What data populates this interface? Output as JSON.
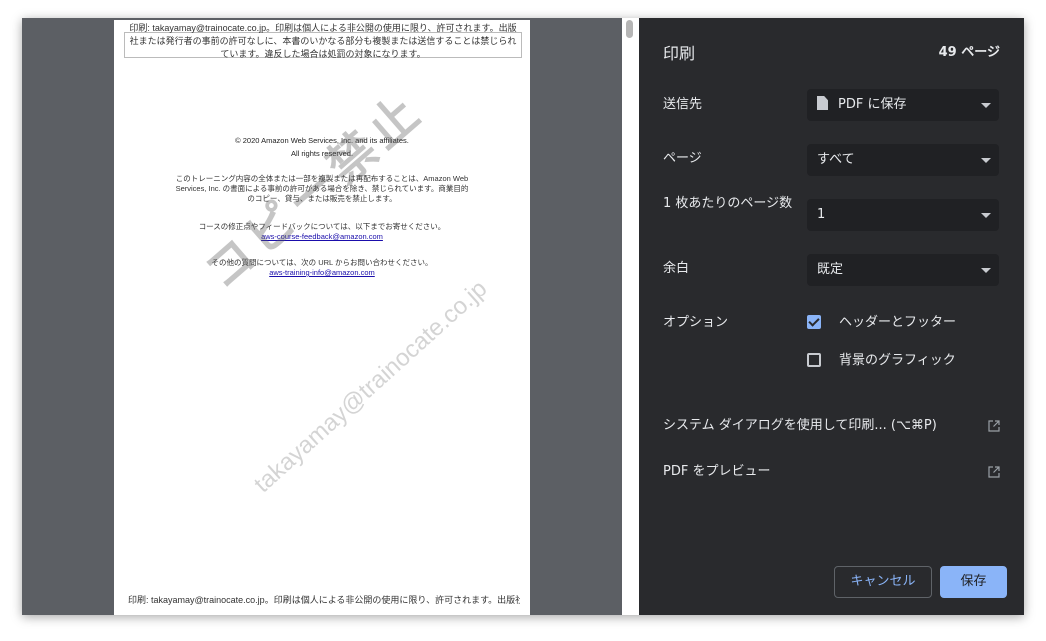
{
  "preview": {
    "header_text": "印刷: takayamay@trainocate.co.jp。印刷は個人による非公開の使用に限り、許可されます。出版社または発行者の事前の許可なしに、本書のいかなる部分も複製または送信することは禁じられています。違反した場合は処罰の対象になります。",
    "copyright_line1": "© 2020 Amazon Web Services, Inc. and its affiliates.",
    "copyright_line2": "All rights reserved.",
    "para1": "このトレーニング内容の全体または一部を複製または再配布することは、Amazon Web Services, Inc. の書面による事前の許可がある場合を除き、禁じられています。商業目的のコピー、貸与、または販売を禁止します。",
    "para2_text": "コースの修正点やフィードバックについては、以下までお寄せください。",
    "para2_link": "aws-course-feedback@amazon.com",
    "para3_text": "その他の質問については、次の URL からお問い合わせください。",
    "para3_link": "aws-training-info@amazon.com",
    "watermark_main": "コピー禁止",
    "watermark_email": "takayamay@trainocate.co.jp",
    "footer_text": "印刷: takayamay@trainocate.co.jp。印刷は個人による非公開の使用に限り、許可されます。出版社ま"
  },
  "panel": {
    "title": "印刷",
    "page_count": "49 ページ",
    "destination": {
      "label": "送信先",
      "value": "PDF に保存",
      "icon": "file-icon"
    },
    "pages": {
      "label": "ページ",
      "value": "すべて"
    },
    "pages_per_sheet": {
      "label": "1 枚あたりのページ数",
      "value": "1"
    },
    "margins": {
      "label": "余白",
      "value": "既定"
    },
    "options": {
      "label": "オプション",
      "headers_footers": {
        "label": "ヘッダーとフッター",
        "checked": true
      },
      "background_graphics": {
        "label": "背景のグラフィック",
        "checked": false
      }
    },
    "system_dialog": "システム ダイアログを使用して印刷... (⌥⌘P)",
    "open_pdf_preview": "PDF をプレビュー",
    "cancel_button": "キャンセル",
    "save_button": "保存"
  },
  "colors": {
    "panel_bg": "#292a2d",
    "select_bg": "#202124",
    "accent": "#8ab4f8",
    "preview_bg": "#5c5f64"
  }
}
